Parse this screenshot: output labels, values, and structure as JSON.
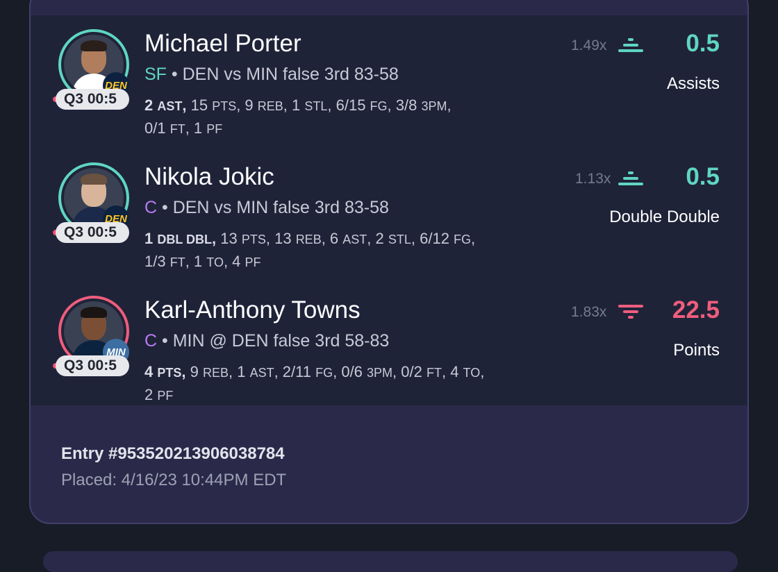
{
  "picks": [
    {
      "name": "Michael Porter",
      "position": "SF",
      "matchup": " • DEN vs MIN false 3rd 83-58",
      "clock": "Q3 00:5",
      "team": "DEN",
      "multiplier": "1.49x",
      "line": "0.5",
      "stat_type": "Assists",
      "direction": "up",
      "stats_html": "<b>2 <span style=\"font-size:18px\">AST</span>,</b> 15 <span style=\"font-size:18px\">PTS</span>, 9 <span style=\"font-size:18px\">REB</span>, 1 <span style=\"font-size:18px\">STL</span>, 6/15 <span style=\"font-size:18px\">FG</span>, 3/8 <span style=\"font-size:18px\">3PM</span>,<br>0/1 <span style=\"font-size:18px\">FT</span>, 1 <span style=\"font-size:18px\">PF</span>"
    },
    {
      "name": "Nikola Jokic",
      "position": "C",
      "matchup": " • DEN vs MIN false 3rd 83-58",
      "clock": "Q3 00:5",
      "team": "DEN",
      "multiplier": "1.13x",
      "line": "0.5",
      "stat_type": "Double Double",
      "direction": "up",
      "stats_html": "<b>1 <span style=\"font-size:18px\">DBL DBL</span>,</b> 13 <span style=\"font-size:18px\">PTS</span>, 13 <span style=\"font-size:18px\">REB</span>, 6 <span style=\"font-size:18px\">AST</span>, 2 <span style=\"font-size:18px\">STL</span>, 6/12 <span style=\"font-size:18px\">FG</span>,<br>1/3 <span style=\"font-size:18px\">FT</span>, 1 <span style=\"font-size:18px\">TO</span>, 4 <span style=\"font-size:18px\">PF</span>"
    },
    {
      "name": "Karl-Anthony Towns",
      "position": "C",
      "matchup": " • MIN @ DEN false 3rd 58-83",
      "clock": "Q3 00:5",
      "team": "MIN",
      "multiplier": "1.83x",
      "line": "22.5",
      "stat_type": "Points",
      "direction": "down",
      "stats_html": "<b>4 <span style=\"font-size:18px\">PTS</span>,</b> 9 <span style=\"font-size:18px\">REB</span>, 1 <span style=\"font-size:18px\">AST</span>, 2/11 <span style=\"font-size:18px\">FG</span>, 0/6 <span style=\"font-size:18px\">3PM</span>, 0/2 <span style=\"font-size:18px\">FT</span>, 4 <span style=\"font-size:18px\">TO</span>,<br>2 <span style=\"font-size:18px\">PF</span>"
    }
  ],
  "entry": {
    "id": "Entry #9535202139060387​84",
    "placed": "Placed: 4/16/23 10:44PM EDT"
  },
  "colors": {
    "more": "#5fd6c0",
    "less": "#ef5d7d",
    "pos_sf": "#5fd6c0",
    "pos_c": "#b77cf2"
  }
}
